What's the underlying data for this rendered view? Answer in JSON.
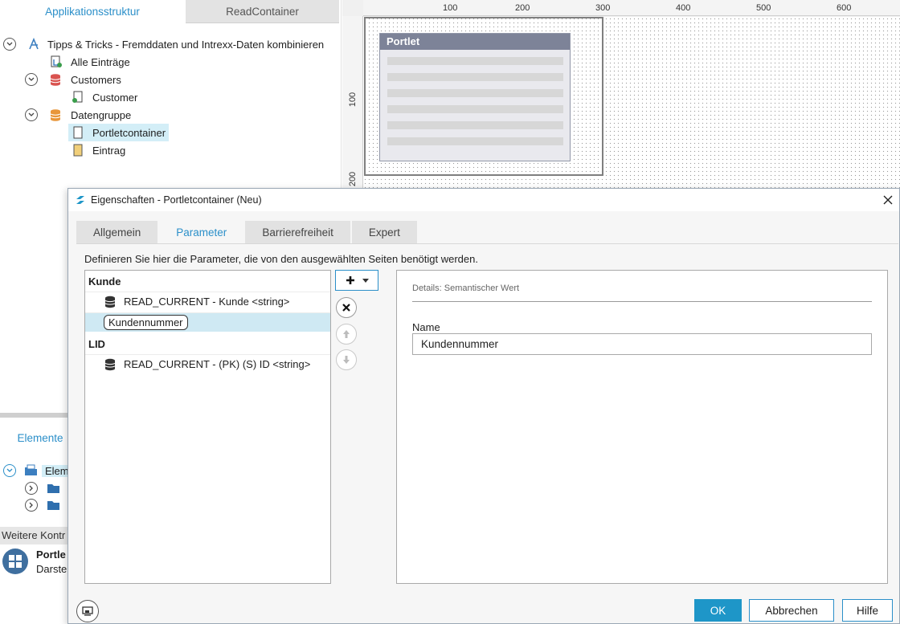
{
  "left_panel": {
    "tabs": [
      {
        "label": "Applikationsstruktur"
      },
      {
        "label": "ReadContainer"
      }
    ],
    "tree": [
      {
        "label": "Tipps & Tricks - Fremddaten und Intrexx-Daten kombinieren",
        "icon": "app-icon"
      },
      {
        "label": "Alle Einträge",
        "icon": "page-link-icon"
      },
      {
        "label": "Customers",
        "icon": "database-group-icon"
      },
      {
        "label": "Customer",
        "icon": "page-icon"
      },
      {
        "label": "Datengruppe",
        "icon": "database-group-icon"
      },
      {
        "label": "Portletcontainer",
        "icon": "portlet-page-icon"
      },
      {
        "label": "Eintrag",
        "icon": "entry-page-icon"
      }
    ],
    "elements_tab": "Elemente",
    "elements_root": "Elem",
    "weitere_label": "Weitere Kontr",
    "portlet_ctl": {
      "title": "Portle",
      "subtitle": "Darste"
    }
  },
  "designer": {
    "ruler_h": [
      "100",
      "200",
      "300",
      "400",
      "500",
      "600"
    ],
    "ruler_v": [
      "100",
      "200"
    ],
    "portlet_title": "Portlet"
  },
  "dialog": {
    "title": "Eigenschaften - Portletcontainer (Neu)",
    "tabs": [
      {
        "label": "Allgemein"
      },
      {
        "label": "Parameter"
      },
      {
        "label": "Barrierefreiheit"
      },
      {
        "label": "Expert"
      }
    ],
    "active_tab": "Parameter",
    "description": "Definieren Sie hier die Parameter, die von den ausgewählten Seiten benötigt werden.",
    "groups": [
      {
        "name": "Kunde",
        "items": [
          {
            "label": "READ_CURRENT - Kunde <string>"
          },
          {
            "label": "Kundennummer",
            "selected": true
          }
        ]
      },
      {
        "name": "LID",
        "items": [
          {
            "label": "READ_CURRENT - (PK) (S) ID <string>"
          }
        ]
      }
    ],
    "details": {
      "header": "Details: Semantischer Wert",
      "name_label": "Name",
      "name_value": "Kundennummer"
    },
    "buttons": {
      "ok": "OK",
      "cancel": "Abbrechen",
      "help": "Hilfe"
    },
    "colors": {
      "accent": "#1e96c8",
      "selection": "#cfe9f3"
    }
  }
}
